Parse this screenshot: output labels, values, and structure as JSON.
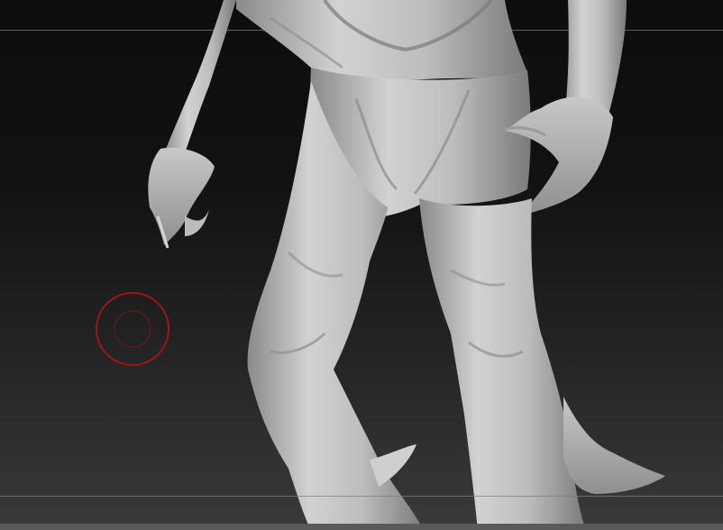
{
  "viewport": {
    "background_top_color": "#0d0d0d",
    "background_bottom_color": "#3a3a3a",
    "guide_line_color": "#7d7d7d"
  },
  "model": {
    "material_color": "#c9c9c9",
    "shadow_color": "#6f6f6f"
  },
  "brush_cursor": {
    "color": "#a01616",
    "icon": "brush-cursor-icon"
  }
}
